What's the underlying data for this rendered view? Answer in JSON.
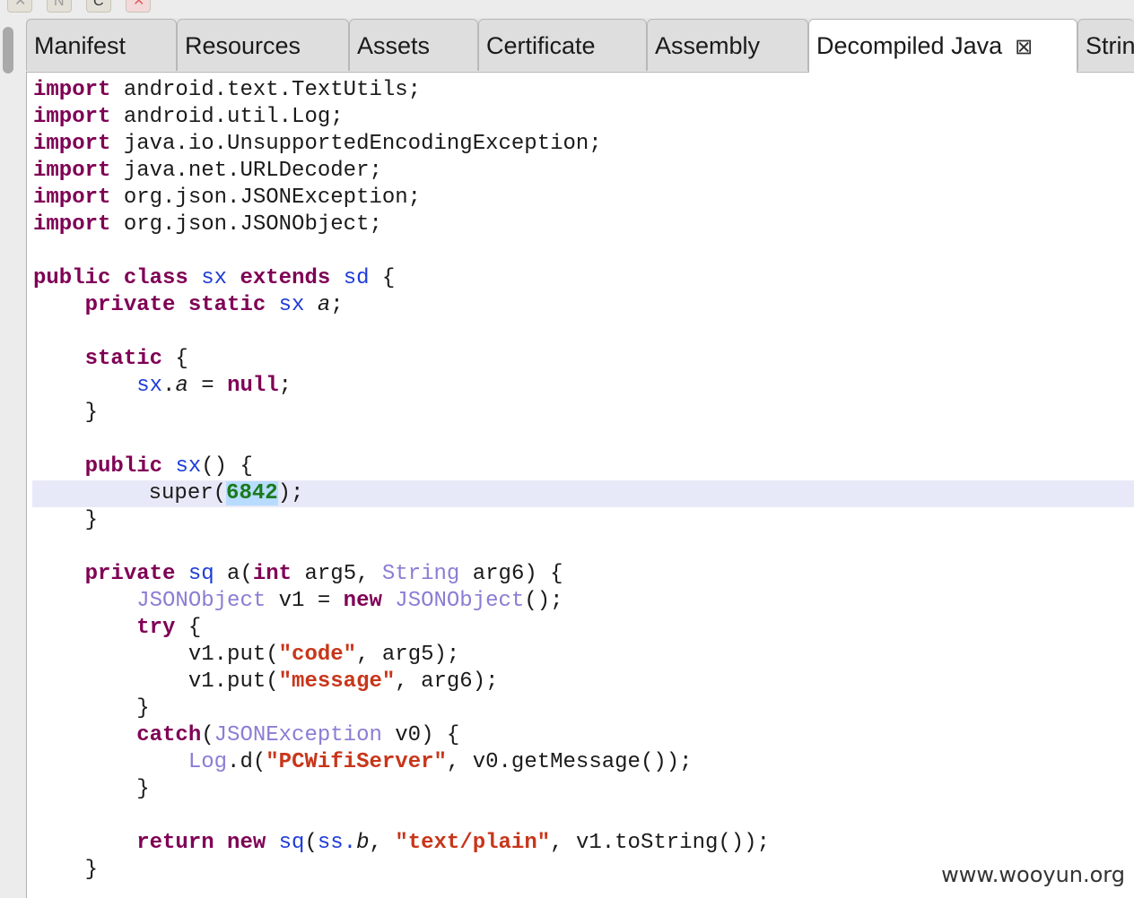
{
  "tabs": [
    {
      "label": "Manifest"
    },
    {
      "label": "Resources"
    },
    {
      "label": "Assets"
    },
    {
      "label": "Certificate"
    },
    {
      "label": "Assembly"
    },
    {
      "label": "Decompiled Java",
      "active": true,
      "close_icon": "close-tab-icon"
    },
    {
      "label": "Strin"
    }
  ],
  "toolbar_icons": [
    "tool-icon-1",
    "tool-icon-2",
    "tool-icon-3",
    "close-red-icon"
  ],
  "code": {
    "l1_kw": "import",
    "l1_rest": " android.text.TextUtils;",
    "l2_kw": "import",
    "l2_rest": " android.util.Log;",
    "l3_kw": "import",
    "l3_rest": " java.io.UnsupportedEncodingException;",
    "l4_kw": "import",
    "l4_rest": " java.net.URLDecoder;",
    "l5_kw": "import",
    "l5_rest": " org.json.JSONException;",
    "l6_kw": "import",
    "l6_rest": " org.json.JSONObject;",
    "l8_kw1": "public class",
    "l8_t1": "sx",
    "l8_kw2": "extends",
    "l8_t2": "sd",
    "l8_rest": " {",
    "l9_kw": "private static",
    "l9_t": "sx",
    "l9_f": "a",
    "l9_rest": ";",
    "l11_kw": "static",
    "l11_rest": " {",
    "l12_t": "sx",
    "l12_dot": ".",
    "l12_f": "a",
    "l12_eq": " = ",
    "l12_kw": "null",
    "l12_rest": ";",
    "l13": "}",
    "l15_kw": "public",
    "l15_t": "sx",
    "l15_rest": "() {",
    "l16_a": "super(",
    "l16_num": "6842",
    "l16_b": ");",
    "l17": "}",
    "l19_kw": "private",
    "l19_t": "sq",
    "l19_a": " a(",
    "l19_kw2": "int",
    "l19_b": " arg5, ",
    "l19_t2": "String",
    "l19_c": " arg6) {",
    "l20_t": "JSONObject",
    "l20_a": " v1 = ",
    "l20_kw": "new",
    "l20_t2": "JSONObject",
    "l20_b": "();",
    "l21_kw": "try",
    "l21_rest": " {",
    "l22_a": "v1.put(",
    "l22_s": "\"code\"",
    "l22_b": ", arg5);",
    "l23_a": "v1.put(",
    "l23_s": "\"message\"",
    "l23_b": ", arg6);",
    "l24": "}",
    "l25_kw": "catch",
    "l25_a": "(",
    "l25_t": "JSONException",
    "l25_b": " v0) {",
    "l26_t": "Log",
    "l26_a": ".d(",
    "l26_s": "\"PCWifiServer\"",
    "l26_b": ", v0.getMessage());",
    "l27": "}",
    "l29_kw": "return new",
    "l29_t": "sq",
    "l29_a": "(",
    "l29_t2": "ss",
    "l29_dot": ".",
    "l29_f": "b",
    "l29_b": ", ",
    "l29_s": "\"text/plain\"",
    "l29_c": ", v1.toString());",
    "l30": "}"
  },
  "watermark": "www.wooyun.org",
  "colors": {
    "keyword": "#7f0055",
    "type": "#1e3cd8",
    "string": "#c8361a",
    "number": "#1a7a1a",
    "highlight": "#e8e9f8"
  }
}
